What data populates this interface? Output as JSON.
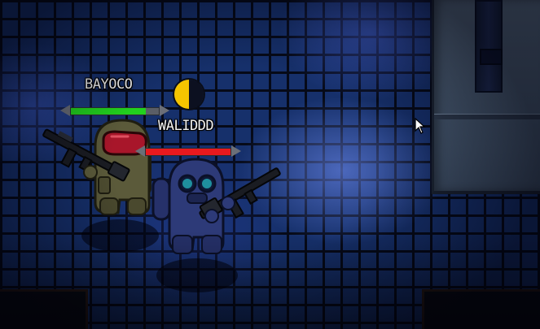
{
  "players": [
    {
      "id": "player-bayoco",
      "name": "BAYOCO",
      "health": 0.85,
      "health_color": "#22d11e",
      "suit_color": "#5b5a3a",
      "visor_color": "#a8162a"
    },
    {
      "id": "player-waliddd",
      "name": "WALIDDD",
      "health": 1.0,
      "health_color": "#e8191e",
      "suit_color": "#2d3a78",
      "visor_color": "#1f8f9e"
    }
  ],
  "icons": {
    "phase": "half-moon-icon",
    "cursor": "mouse-pointer-icon"
  },
  "colors": {
    "floor_tile": "#16306b",
    "grout": "#060a18",
    "wall": "#4a5d74"
  }
}
